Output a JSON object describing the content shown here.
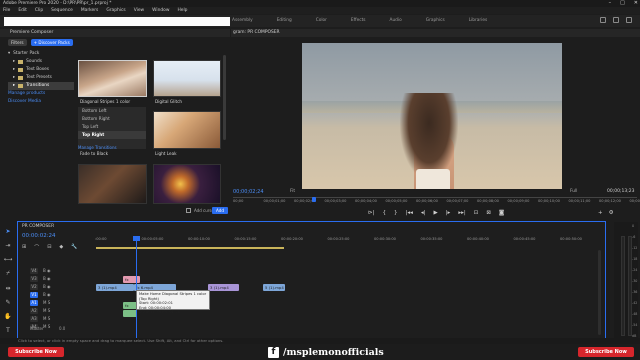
{
  "window": {
    "title": "Adobe Premiere Pro 2020 - D:\\PR\\PR\\pr_1.prproj *",
    "controls": [
      "–",
      "□",
      "✕"
    ]
  },
  "menu": [
    "File",
    "Edit",
    "Clip",
    "Sequence",
    "Markers",
    "Graphics",
    "View",
    "Window",
    "Help"
  ],
  "workspace_tabs": [
    "Assembly",
    "Editing",
    "Color",
    "Effects",
    "Audio",
    "Graphics",
    "Libraries"
  ],
  "project": {
    "tab": "Premiere Composer",
    "filters_label": "Filters",
    "discover_label": "+ Discover Packs",
    "tree": [
      {
        "label": "Starter Pack",
        "type": "root"
      },
      {
        "label": "Sounds",
        "type": "folder"
      },
      {
        "label": "Text Boxes",
        "type": "folder"
      },
      {
        "label": "Text Presets",
        "type": "folder"
      },
      {
        "label": "Transitions",
        "type": "folder",
        "selected": true
      },
      {
        "label": "Manage products",
        "type": "link"
      },
      {
        "label": "Discover Media",
        "type": "link"
      }
    ],
    "thumbs": [
      {
        "label": "Diagonal Stripes 1 color"
      },
      {
        "label": "Digital Glitch"
      },
      {
        "label": "Light Leak"
      },
      {
        "label": "Fade to Black"
      },
      {
        "label": ""
      }
    ],
    "submenu": [
      "Bottom Left",
      "Bottom Right",
      "Top Left",
      "Top Right"
    ],
    "submenu_selected": "Top Right",
    "more_label": "Manage Transitions",
    "add_cursor_label": "Add cursor",
    "add_button": "Add"
  },
  "program": {
    "tab": "gram: PR COMPOSER",
    "timecode": "00;00;02;24",
    "fit": "Fit",
    "quality": "Full",
    "duration": "00;00;13;23",
    "ruler": [
      "00;00",
      "00;00;01;00",
      "00;00;02;00",
      "00;00;03;00",
      "00;00;04;00",
      "00;00;05;00",
      "00;00;06;00",
      "00;00;07;00",
      "00;00;08;00",
      "00;00;09;00",
      "00;00;10;00",
      "00;00;11;00",
      "00;00;12;00",
      "00;00;13;00"
    ],
    "transport": [
      "⊳|",
      "{",
      "}",
      "|◂◂",
      "◂|",
      "▶",
      "|▸",
      "▸▸|",
      "⊡",
      "⊠",
      "◙"
    ],
    "extra": [
      "+",
      "⚙"
    ]
  },
  "timeline": {
    "tab": "PR COMPOSER",
    "timecode": "00:00:02:24",
    "ctrls": [
      "⊞",
      "⌒",
      "⊟",
      "◆",
      "🔧"
    ],
    "ruler": [
      ":00:00",
      "00:00:05:00",
      "00:00:10:00",
      "00:00:15:00",
      "00:00:20:00",
      "00:00:25:00",
      "00:00:30:00",
      "00:00:35:00",
      "00:00:40:00",
      "00:00:45:00",
      "00:00:50:00"
    ],
    "tracks": [
      {
        "name": "V4",
        "flags": "B ◉"
      },
      {
        "name": "V3",
        "flags": "B ◉"
      },
      {
        "name": "V2",
        "flags": "B ◉"
      },
      {
        "name": "V1",
        "flags": "B ◉",
        "on": true
      },
      {
        "name": "A1",
        "flags": "M S"
      },
      {
        "name": "A2",
        "flags": "M S"
      },
      {
        "name": "A3",
        "flags": "M S"
      },
      {
        "name": "A4",
        "flags": "M S"
      }
    ],
    "clips": {
      "c1": "fx",
      "c2": "3 (1).mp4",
      "c3": "fx 6.mp4",
      "c4": "3 (1).mp4",
      "c5": "5 (1).mp4",
      "c6": "fx",
      "c7": ""
    },
    "tooltip": [
      "Make Home Diagonal Stripes 1 color (Top Right)",
      "Start: 00:00:02:01",
      "End: 00:00:04:00",
      "Duration: 00:00:01:26"
    ],
    "master": "Master",
    "master_val": "0.0"
  },
  "meter": {
    "scale": [
      "0",
      "-6",
      "-12",
      "-18",
      "-24",
      "-30",
      "-36",
      "-42",
      "-48",
      "-54",
      "dB"
    ],
    "channels": [
      "S",
      "S"
    ]
  },
  "status": "Click to select, or click in empty space and drag to marquee select. Use Shift, Alt, and Ctrl for other options.",
  "banner": {
    "subscribe_left": "Subscribe Now",
    "subscribe_right": "Subscribe Now",
    "fb_icon": "f",
    "handle": "/msplemonofficials"
  },
  "colors": {
    "accent": "#2a6df0",
    "subscribe": "#d7262c",
    "workarea": "#c9b45a"
  }
}
